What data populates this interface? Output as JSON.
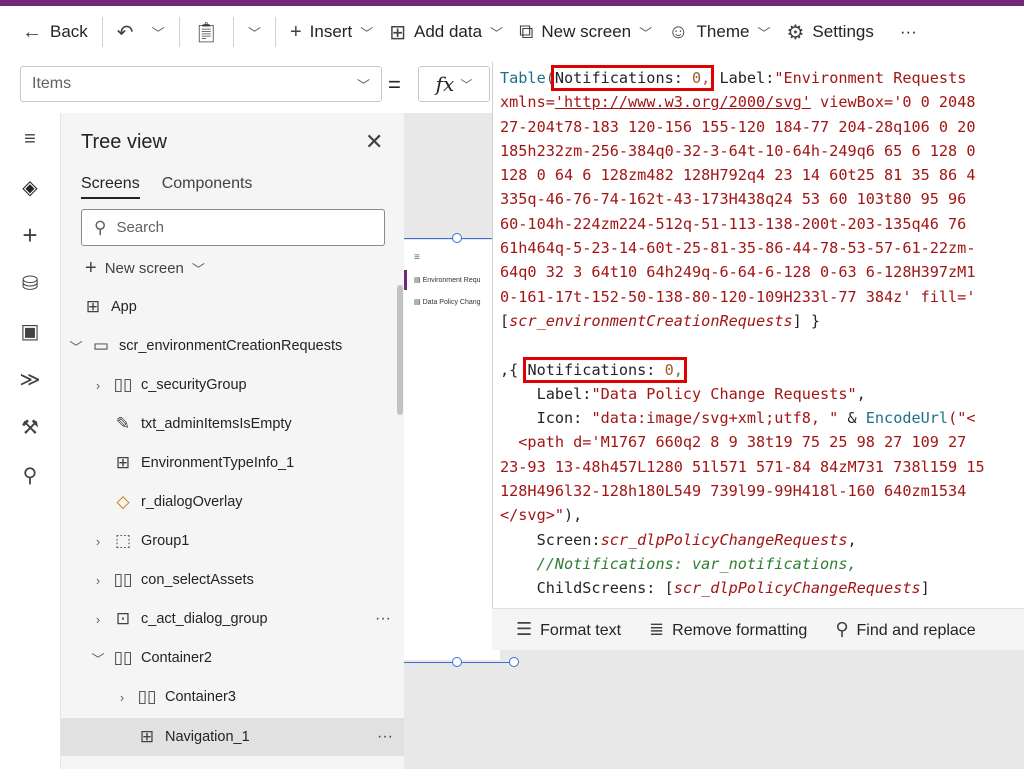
{
  "cmdbar": {
    "back": "Back",
    "insert": "Insert",
    "add_data": "Add data",
    "new_screen": "New screen",
    "theme": "Theme",
    "settings": "Settings",
    "more": "···"
  },
  "formula": {
    "property": "Items",
    "equals": "=",
    "fx": "fx"
  },
  "tree": {
    "title": "Tree view",
    "tabs": [
      "Screens",
      "Components"
    ],
    "search_placeholder": "Search",
    "new_screen": "New screen",
    "nodes": [
      {
        "label": "App"
      },
      {
        "label": "scr_environmentCreationRequests"
      },
      {
        "label": "c_securityGroup"
      },
      {
        "label": "txt_adminItemsIsEmpty"
      },
      {
        "label": "EnvironmentTypeInfo_1"
      },
      {
        "label": "r_dialogOverlay"
      },
      {
        "label": "Group1"
      },
      {
        "label": "con_selectAssets"
      },
      {
        "label": "c_act_dialog_group"
      },
      {
        "label": "Container2"
      },
      {
        "label": "Container3"
      },
      {
        "label": "Navigation_1"
      }
    ]
  },
  "preview": {
    "item1": "Environment Requ",
    "item2": "Data Policy Chang"
  },
  "code": {
    "l1a": "Table(",
    "l1b": "Notifications: ",
    "l1c": "0,",
    "l1d": " Label:",
    "l1e": "\"Environment Requests",
    "l2a": "xmlns=",
    "l2b": "'http://www.w3.org/2000/svg'",
    "l2c": " viewBox='0 0 2048",
    "l3": "27-204t78-183 120-156 155-120 184-77 204-28q106 0 20",
    "l4": "185h232zm-256-384q0-32-3-64t-10-64h-249q6 65 6 128 0",
    "l5": "128 0 64 6 128zm482 128H792q4 23 14 60t25 81 35 86 4",
    "l6": "335q-46-76-74-162t-43-173H438q24 53 60 103t80 95 96",
    "l7": "60-104h-224zm224-512q-51-113-138-200t-203-135q46 76",
    "l8": "61h464q-5-23-14-60t-25-81-35-86-44-78-53-57-61-22zm-",
    "l9": "64q0 32 3 64t10 64h249q-6-64-6-128 0-63 6-128H397zM1",
    "l10": "0-161-17t-152-50-138-80-120-109H233l-77 384z' fill='",
    "l11a": "[",
    "l11b": "scr_environmentCreationRequests",
    "l11c": "] }",
    "l13a": ",{ ",
    "l13b": "Notifications: ",
    "l13c": "0,",
    "l14a": "    Label:",
    "l14b": "\"Data Policy Change Requests\"",
    "l14c": ",",
    "l15a": "    Icon: ",
    "l15b": "\"data:image/svg+xml;utf8, \"",
    "l15c": " & ",
    "l15d": "EncodeUrl",
    "l15e": "(\"<",
    "l16": "  <path d='M1767 660q2 8 9 38t19 75 25 98 27 109 27 ",
    "l17": "23-93 13-48h457L1280 51l571 571-84 84zM731 738l159 15",
    "l18": "128H496l32-128h180L549 739l99-99H418l-160 640zm1534 ",
    "l19a": "</svg>\"",
    "l19b": "),",
    "l20a": "    Screen:",
    "l20b": "scr_dlpPolicyChangeRequests",
    "l20c": ",",
    "l21": "    //Notifications: var_notifications,",
    "l22a": "    ChildScreens: [",
    "l22b": "scr_dlpPolicyChangeRequests",
    "l22c": "]"
  },
  "editor_footer": {
    "format": "Format text",
    "remove": "Remove formatting",
    "find": "Find and replace"
  }
}
